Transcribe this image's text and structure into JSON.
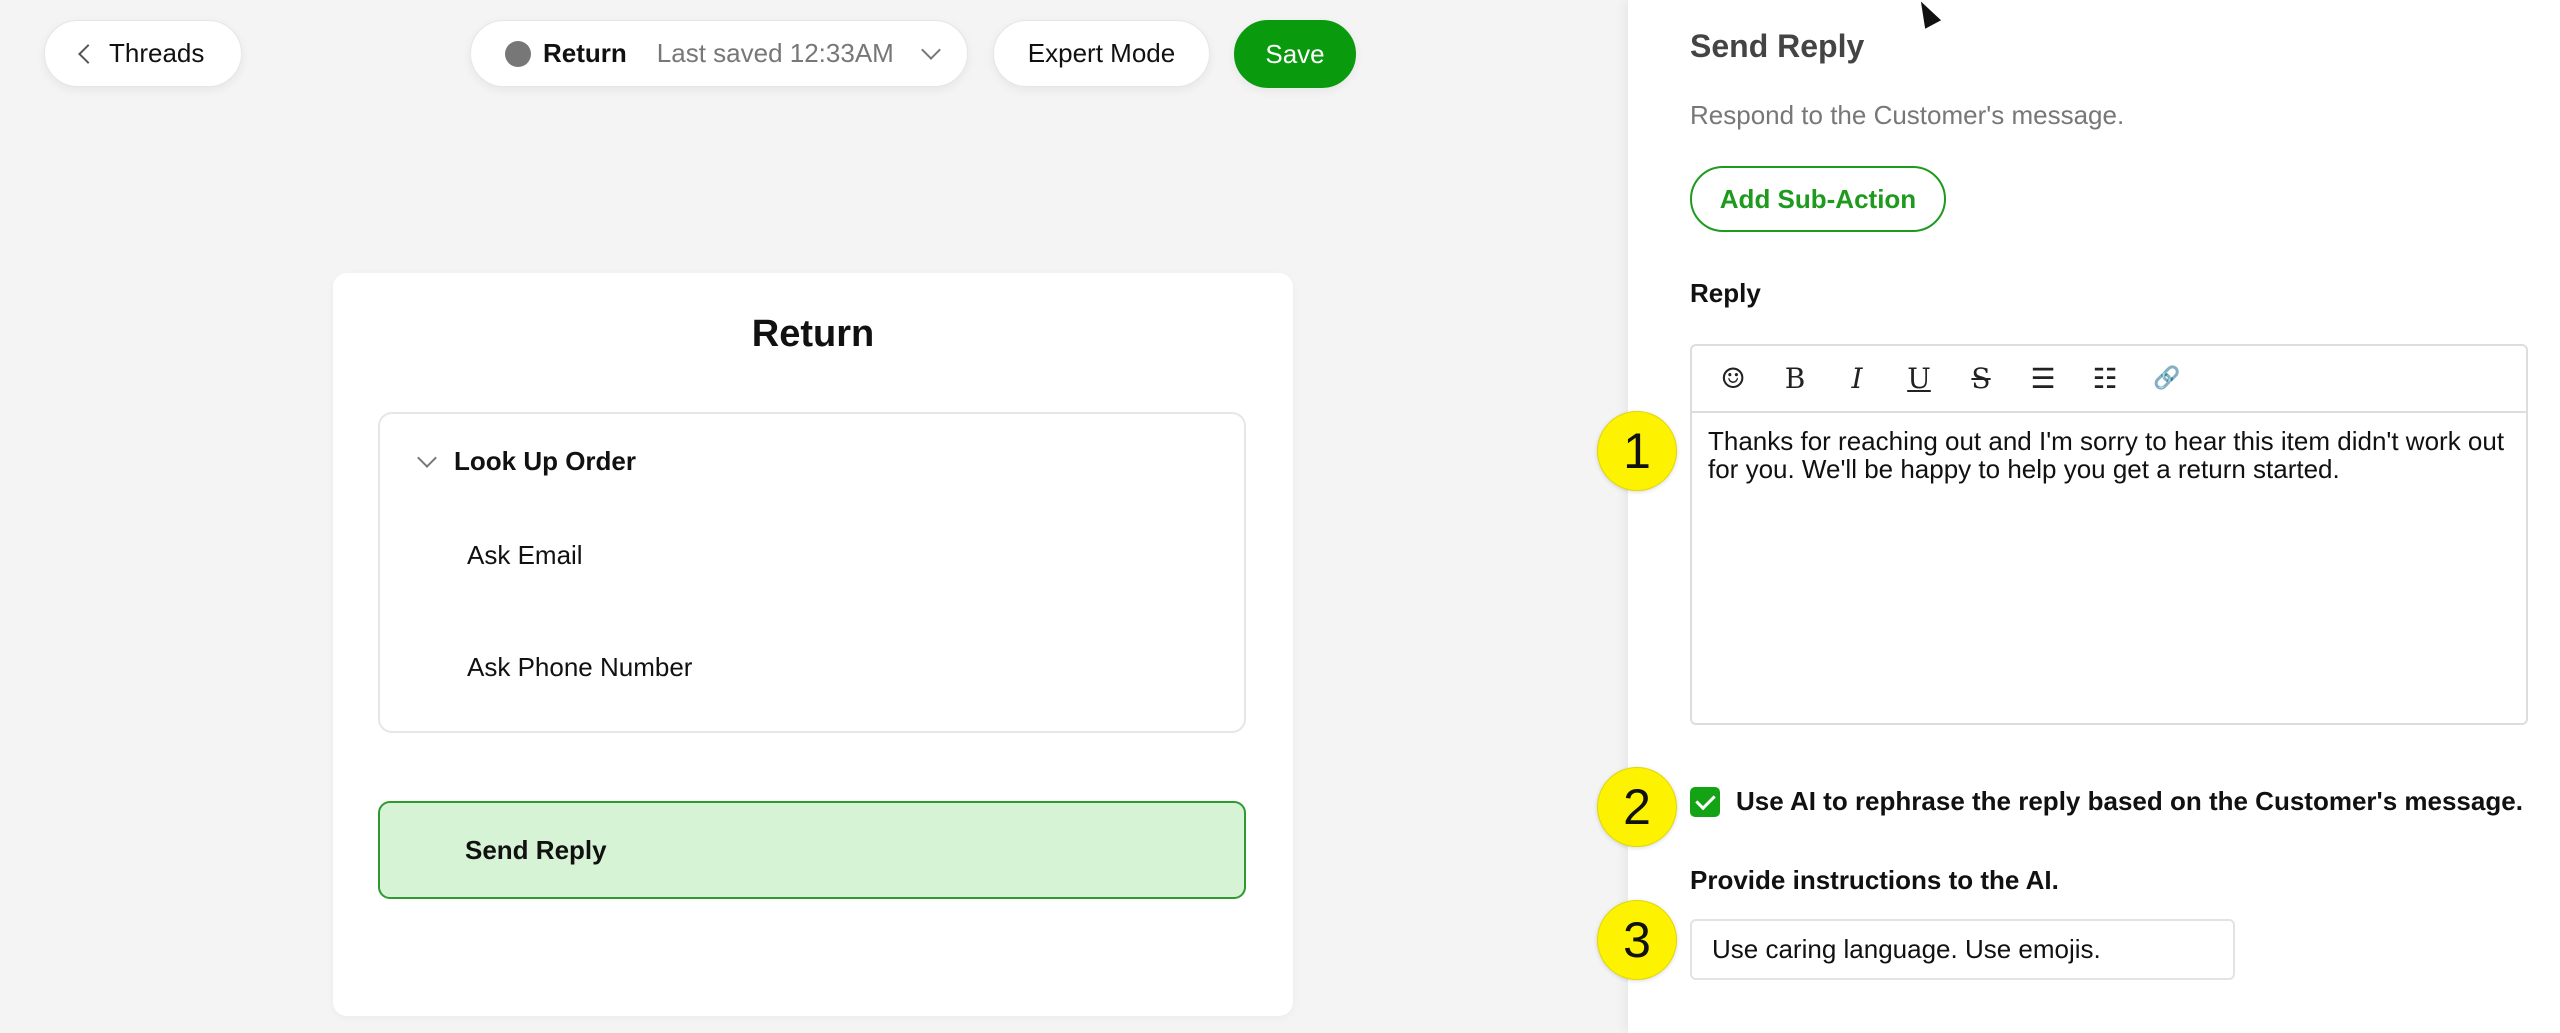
{
  "topbar": {
    "back_label": "Threads",
    "flow_name": "Return",
    "last_saved": "Last saved 12:33AM",
    "expert_label": "Expert Mode",
    "save_label": "Save"
  },
  "flow": {
    "title": "Return",
    "group": {
      "label": "Look Up Order",
      "expanded": true,
      "items": [
        "Ask Email",
        "Ask Phone Number"
      ]
    },
    "selected_step": "Send Reply"
  },
  "panel": {
    "title": "Send Reply",
    "description": "Respond to the Customer's message.",
    "add_sub_action": "Add Sub-Action",
    "reply_label": "Reply",
    "toolbar": [
      {
        "icon": "emoji-icon",
        "glyph": "☺"
      },
      {
        "icon": "bold-icon",
        "glyph": "B"
      },
      {
        "icon": "italic-icon",
        "glyph": "I"
      },
      {
        "icon": "underline-icon",
        "glyph": "U"
      },
      {
        "icon": "strikethrough-icon",
        "glyph": "S"
      },
      {
        "icon": "ordered-list-icon",
        "glyph": "☰"
      },
      {
        "icon": "bullet-list-icon",
        "glyph": "☷"
      },
      {
        "icon": "link-icon",
        "glyph": "🔗"
      }
    ],
    "reply_text": "Thanks for reaching out and I'm sorry to hear this item didn't work out for you. We'll be happy to help you get a return started.",
    "ai_rephrase_label": "Use AI to rephrase the reply based on the Customer's message.",
    "ai_rephrase_checked": true,
    "instructions_label": "Provide instructions to the AI.",
    "instructions_value": "Use caring language. Use emojis."
  },
  "annotations": [
    "1",
    "2",
    "3"
  ],
  "colors": {
    "accent_green": "#0a9a0e",
    "selected_step_bg": "#d6f3d6",
    "annotation_yellow": "#fdf200"
  }
}
